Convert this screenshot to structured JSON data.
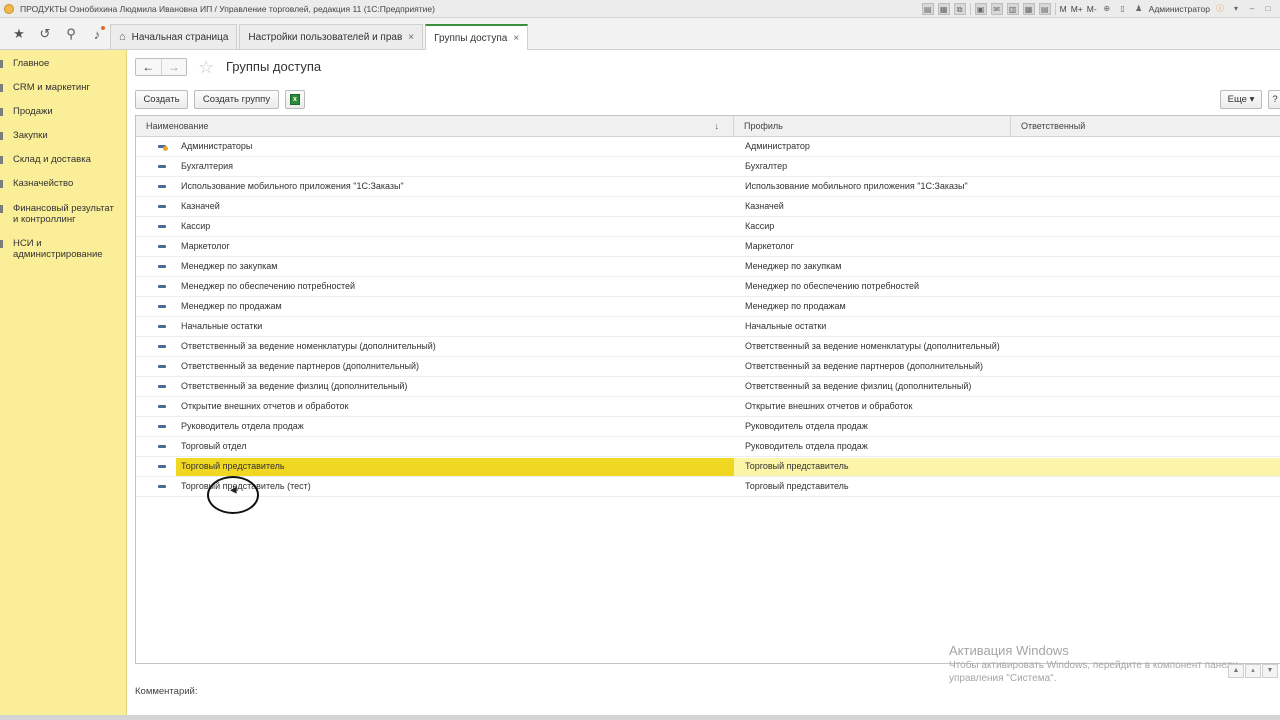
{
  "window": {
    "title": "ПРОДУКТЫ Ознобихина Людмила Ивановна ИП / Управление торговлей, редакция 11  (1С:Предприятие)",
    "user": "Администратор",
    "memory_buttons": [
      "M",
      "M+",
      "M-"
    ]
  },
  "tabs": [
    {
      "label": "Начальная страница",
      "icon": "home-icon"
    },
    {
      "label": "Настройки пользователей и прав",
      "close": "×"
    },
    {
      "label": "Группы доступа",
      "close": "×"
    }
  ],
  "sidebar": {
    "items": [
      {
        "label": "Главное"
      },
      {
        "label": "CRM и маркетинг"
      },
      {
        "label": "Продажи"
      },
      {
        "label": "Закупки"
      },
      {
        "label": "Склад и доставка"
      },
      {
        "label": "Казначейство"
      },
      {
        "label": "Финансовый результат и контроллинг"
      },
      {
        "label": "НСИ и администрирование"
      }
    ]
  },
  "page": {
    "title": "Группы доступа",
    "back_arrow": "←",
    "forward_arrow": "→",
    "star": "☆"
  },
  "toolbar": {
    "create": "Создать",
    "create_group": "Создать группу",
    "more": "Еще ▾",
    "help": "?"
  },
  "table": {
    "columns": {
      "name": "Наименование",
      "profile": "Профиль",
      "responsible": "Ответственный",
      "sort_indicator": "↓"
    },
    "rows": [
      {
        "name": "Администраторы",
        "profile": "Администратор"
      },
      {
        "name": "Бухгалтерия",
        "profile": "Бухгалтер"
      },
      {
        "name": "Использование мобильного приложения \"1С:Заказы\"",
        "profile": "Использование мобильного приложения \"1С:Заказы\""
      },
      {
        "name": "Казначей",
        "profile": "Казначей"
      },
      {
        "name": "Кассир",
        "profile": "Кассир"
      },
      {
        "name": "Маркетолог",
        "profile": "Маркетолог"
      },
      {
        "name": "Менеджер по закупкам",
        "profile": "Менеджер по закупкам"
      },
      {
        "name": "Менеджер по обеспечению потребностей",
        "profile": "Менеджер по обеспечению потребностей"
      },
      {
        "name": "Менеджер по продажам",
        "profile": "Менеджер по продажам"
      },
      {
        "name": "Начальные остатки",
        "profile": "Начальные остатки"
      },
      {
        "name": "Ответственный за ведение номенклатуры (дополнительный)",
        "profile": "Ответственный за ведение номенклатуры (дополнительный)"
      },
      {
        "name": "Ответственный за ведение партнеров (дополнительный)",
        "profile": "Ответственный за ведение партнеров (дополнительный)"
      },
      {
        "name": "Ответственный за ведение физлиц (дополнительный)",
        "profile": "Ответственный за ведение физлиц (дополнительный)"
      },
      {
        "name": "Открытие внешних отчетов и обработок",
        "profile": "Открытие внешних отчетов и обработок"
      },
      {
        "name": "Руководитель отдела продаж",
        "profile": "Руководитель отдела продаж"
      },
      {
        "name": "Торговый отдел",
        "profile": "Руководитель отдела продаж"
      },
      {
        "name": "Торговый представитель",
        "profile": "Торговый представитель"
      },
      {
        "name": "Торговый представитель (тест)",
        "profile": "Торговый представитель"
      }
    ]
  },
  "footer": {
    "comment_label": "Комментарий:"
  },
  "watermark": {
    "title": "Активация Windows",
    "subtitle": "Чтобы активировать Windows, перейдите в компонент панели управления \"Система\"."
  },
  "colors": {
    "sidebar_bg": "#fbee99",
    "selected_row": "#f0d722",
    "active_tab_accent": "#3c8c40"
  }
}
